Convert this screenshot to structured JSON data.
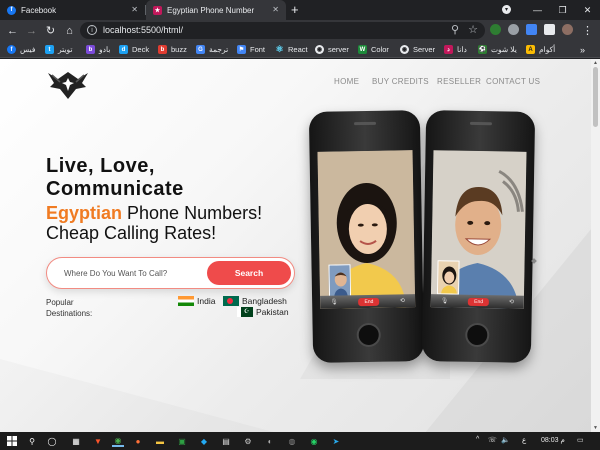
{
  "browser": {
    "tabs": [
      {
        "title": "Facebook",
        "favicon": "facebook-icon",
        "active": false
      },
      {
        "title": "Egyptian Phone Number",
        "favicon": "site-icon",
        "active": true
      }
    ],
    "url": "localhost:5500/html/",
    "bookmarks": [
      {
        "label": "فيس",
        "icon": "facebook-icon",
        "color": "#1877f2"
      },
      {
        "label": "تويتر",
        "icon": "twitter-icon",
        "color": "#1da1f2"
      },
      {
        "label": "بادو",
        "icon": "badoo-icon",
        "color": "#7b4bd9"
      },
      {
        "label": "Deck",
        "icon": "deck-icon",
        "color": "#1da1f2"
      },
      {
        "label": "buzz",
        "icon": "buzz-icon",
        "color": "#e03c31"
      },
      {
        "label": "ترجمة",
        "icon": "translate-icon",
        "color": "#4285f4"
      },
      {
        "label": "Font",
        "icon": "flag-icon",
        "color": "#4285f4"
      },
      {
        "label": "React",
        "icon": "react-icon",
        "color": "#61dafb"
      },
      {
        "label": "server",
        "icon": "server-icon",
        "color": "#e8eaed"
      },
      {
        "label": "Color",
        "icon": "color-icon",
        "color": "#1d8a3a"
      },
      {
        "label": "Server",
        "icon": "server-icon",
        "color": "#e8eaed"
      },
      {
        "label": "دانا",
        "icon": "dana-icon",
        "color": "#c2185b"
      },
      {
        "label": "يلا شوت",
        "icon": "yallashoot-icon",
        "color": "#2e7d32"
      },
      {
        "label": "أكوام",
        "icon": "akwam-icon",
        "color": "#fbbc04"
      }
    ]
  },
  "site": {
    "nav": [
      "HOME",
      "BUY CREDITS",
      "RESELLER",
      "CONTACT US"
    ],
    "headline_1": "Live, Love,",
    "headline_2": "Communicate",
    "sub_1_highlight": "Egyptian",
    "sub_1_rest": " Phone Numbers!",
    "sub_2": "Cheap Calling Rates!",
    "search_placeholder": "Where Do You Want To Call?",
    "search_button": "Search",
    "popular_label_1": "Popular",
    "popular_label_2": "Destinations:",
    "destinations": [
      "India",
      "Bangladesh",
      "Pakistan"
    ],
    "call_end_label": "End"
  },
  "taskbar": {
    "lang": "ع",
    "time": "08:03 م"
  },
  "colors": {
    "accent_orange": "#f07b22",
    "search_button": "#ef4b4b"
  }
}
